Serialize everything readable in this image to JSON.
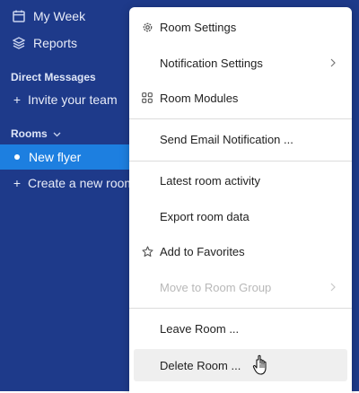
{
  "sidebar": {
    "my_week": "My Week",
    "reports": "Reports",
    "dm_heading": "Direct Messages",
    "invite": "Invite your team",
    "rooms_heading": "Rooms",
    "active_room": "New flyer",
    "create_room": "Create a new room"
  },
  "menu": {
    "room_settings": "Room Settings",
    "notification_settings": "Notification Settings",
    "room_modules": "Room Modules",
    "send_email": "Send Email Notification ...",
    "latest_activity": "Latest room activity",
    "export": "Export room data",
    "favorites": "Add to Favorites",
    "move_group": "Move to Room Group",
    "leave": "Leave Room ...",
    "delete": "Delete Room ..."
  },
  "colors": {
    "sidebar_bg": "#1e3a8a",
    "active_bg": "#1d7fe0",
    "menu_bg": "#ffffff",
    "hover_bg": "#efefef"
  },
  "icons": [
    "calendar-icon",
    "layers-icon",
    "plus-icon",
    "chevron-down-icon",
    "gear-icon",
    "modules-grid-icon",
    "star-icon",
    "chevron-right-icon",
    "hand-cursor-icon"
  ]
}
